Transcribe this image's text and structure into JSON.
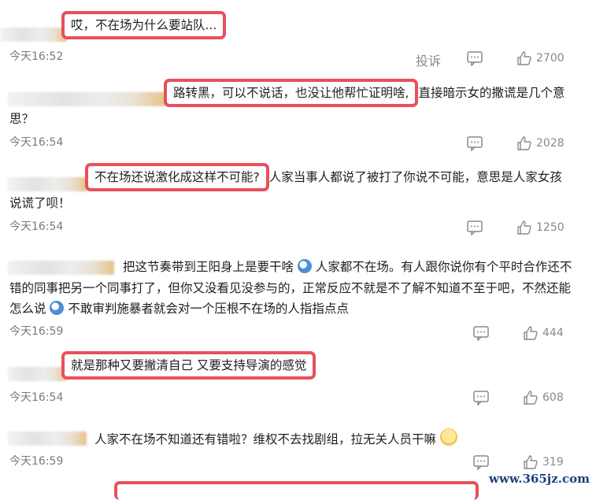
{
  "comments": [
    {
      "text": "哎，不在场为什么要站队...",
      "time": "今天16:52",
      "report": "投诉",
      "likes": "2700"
    },
    {
      "text_hl": "路转黑，可以不说话，也没让他帮忙证明啥,",
      "text_rest": "直接暗示女的撒谎是几个意",
      "text_line2": "思？",
      "time": "今天16:54",
      "likes": "2028"
    },
    {
      "text_hl": "不在场还说激化成这样不可能?",
      "text_rest": "人家当事人都说了被打了你说不可能，意思是人家女孩",
      "text_line2": "说谎了呗！",
      "time": "今天16:54",
      "likes": "1250"
    },
    {
      "line1_a": "把这节奏带到王阳身上是要干啥",
      "line1_b": "人家都不在场。有人跟你说你有个平时合作还不",
      "line2": "错的同事把另一个同事打了，但你又没看见没参与的，正常反应不就是不了解不知道不至于吧，不然还能",
      "line3_a": "怎么说",
      "line3_b": "不敢审判施暴者就会对一个压根不在场的人指指点点",
      "time": "今天16:59",
      "likes": "444"
    },
    {
      "text": "就是那种又要撇清自己 又要支持导演的感觉",
      "time": "今天16:54",
      "likes": "608"
    },
    {
      "text": "人家不在场不知道还有错啦？维权不去找剧组，拉无关人员干嘛",
      "time": "今天16:59",
      "likes": "319"
    }
  ],
  "watermark": "www.365jz.com",
  "colors": {
    "highlight": "#e8505b",
    "text": "#1e1e1e",
    "meta": "#7a7a7a"
  },
  "icons": [
    "comment-icon",
    "like-icon",
    "emoji-icon"
  ]
}
